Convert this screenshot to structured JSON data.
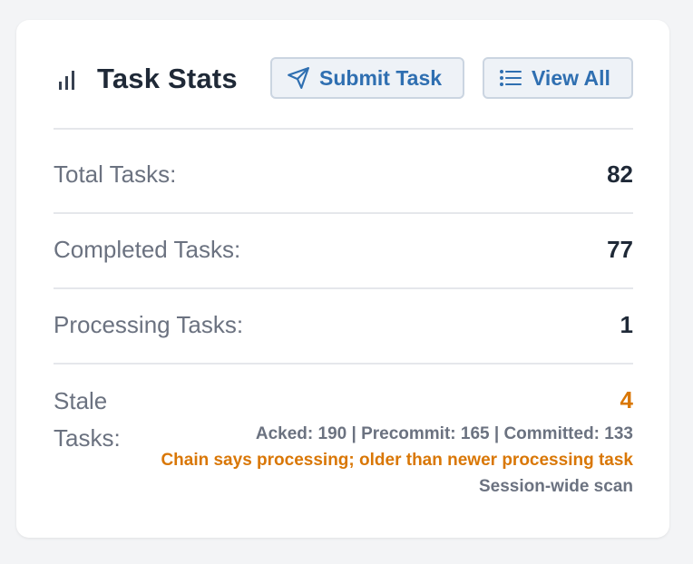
{
  "header": {
    "title": "Task Stats",
    "title_icon": "bar-chart-icon",
    "submit_label": "Submit Task",
    "submit_icon": "send-icon",
    "view_all_label": "View All",
    "view_all_icon": "list-icon"
  },
  "stats": {
    "total_label": "Total Tasks:",
    "total_value": "82",
    "completed_label": "Completed Tasks:",
    "completed_value": "77",
    "processing_label": "Processing Tasks:",
    "processing_value": "1",
    "stale_label": "Stale Tasks:",
    "stale_value": "4",
    "stale_counts": "Acked: 190 | Precommit: 165 | Committed: 133",
    "stale_warning": "Chain says processing; older than newer processing task",
    "stale_scope": "Session-wide scan"
  },
  "colors": {
    "accent": "#2f6fb1",
    "warning": "#d97706",
    "muted": "#6b7280",
    "text": "#1f2937"
  }
}
